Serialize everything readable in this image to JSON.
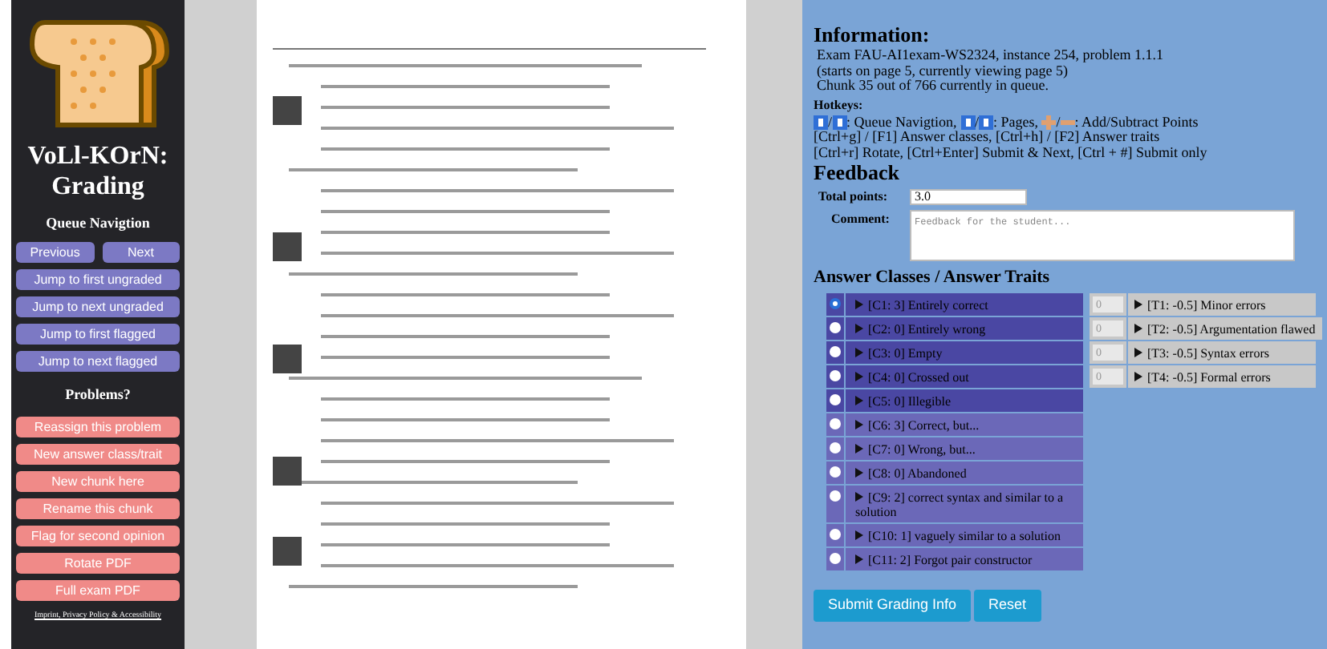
{
  "sidebar": {
    "title": "VoLl-KOrN: Grading",
    "queue_heading": "Queue Navigtion",
    "nav_pair": [
      "Previous",
      "Next"
    ],
    "nav_buttons": [
      "Jump to first ungraded",
      "Jump to next ungraded",
      "Jump to first flagged",
      "Jump to next flagged"
    ],
    "problems_heading": "Problems?",
    "problem_buttons": [
      "Reassign this problem",
      "New answer class/trait",
      "New chunk here",
      "Rename this chunk",
      "Flag for second opinion",
      "Rotate PDF",
      "Full exam PDF"
    ],
    "footer_link": "Imprint, Privacy Policy & Accessibility"
  },
  "information": {
    "heading": "Information:",
    "lines": [
      "Exam FAU-AI1exam-WS2324, instance 254, problem 1.1.1",
      "(starts on page 5, currently viewing page 5)",
      "Chunk 35 out of 766 currently in queue."
    ],
    "hotkeys_heading": "Hotkeys:",
    "hotkeys": [
      {
        "kind": "keys",
        "parts": [
          "/",
          ": Queue Navigtion, ",
          "/",
          ": Pages, ",
          "/",
          ": Add/Subtract Points"
        ]
      },
      {
        "kind": "text",
        "text": "[Ctrl+g] / [F1] Answer classes, [Ctrl+h] / [F2] Answer traits"
      },
      {
        "kind": "text",
        "text": "[Ctrl+r] Rotate, [Ctrl+Enter] Submit & Next, [Ctrl + #] Submit only"
      }
    ]
  },
  "feedback": {
    "heading": "Feedback",
    "total_label": "Total points:",
    "total_value": "3.0",
    "comment_label": "Comment:",
    "comment_placeholder": "Feedback for the student..."
  },
  "answers": {
    "heading": "Answer Classes / Answer Traits",
    "classes": [
      {
        "label": "[C1: 3] Entirely correct",
        "selected": true,
        "highlighted": true
      },
      {
        "label": "[C2: 0] Entirely wrong",
        "selected": false,
        "highlighted": true
      },
      {
        "label": "[C3: 0] Empty",
        "selected": false,
        "highlighted": true
      },
      {
        "label": "[C4: 0] Crossed out",
        "selected": false,
        "highlighted": true
      },
      {
        "label": "[C5: 0] Illegible",
        "selected": false,
        "highlighted": true
      },
      {
        "label": "[C6: 3] Correct, but...",
        "selected": false,
        "highlighted": false
      },
      {
        "label": "[C7: 0] Wrong, but...",
        "selected": false,
        "highlighted": false
      },
      {
        "label": "[C8: 0] Abandoned",
        "selected": false,
        "highlighted": false
      },
      {
        "label": "[C9: 2] correct syntax and similar to a solution",
        "selected": false,
        "highlighted": false
      },
      {
        "label": "[C10: 1] vaguely similar to a solution",
        "selected": false,
        "highlighted": false
      },
      {
        "label": "[C11: 2] Forgot pair constructor",
        "selected": false,
        "highlighted": false
      }
    ],
    "traits": [
      {
        "label": "[T1: -0.5] Minor errors",
        "value": "0",
        "disabled": true
      },
      {
        "label": "[T2: -0.5] Argumentation flawed",
        "value": "0",
        "disabled": true
      },
      {
        "label": "[T3: -0.5] Syntax errors",
        "value": "0",
        "disabled": true
      },
      {
        "label": "[T4: -0.5] Formal errors",
        "value": "0",
        "disabled": true
      }
    ]
  },
  "buttons": [
    "Submit Grading Info",
    "Reset"
  ]
}
